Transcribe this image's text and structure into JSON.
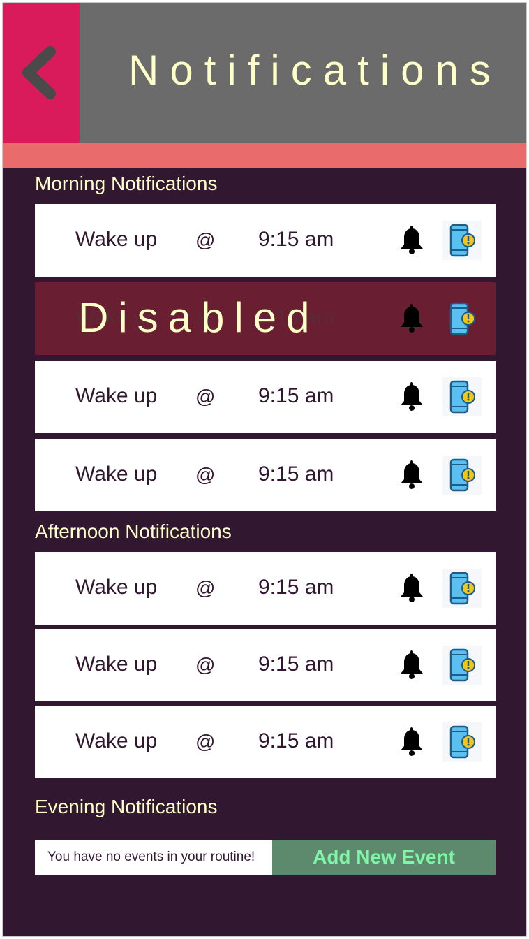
{
  "header": {
    "title": "Notifications",
    "back_icon": "chevron-left-icon",
    "colors": {
      "bar": "#6b6b6b",
      "back": "#d91b5c",
      "strip": "#ea6b6b"
    }
  },
  "sections": {
    "morning": {
      "title": "Morning Notifications",
      "items": [
        {
          "label": "Wake up",
          "at": "@",
          "time": "9:15 am",
          "disabled": false
        },
        {
          "label": "Wake up",
          "at": "@",
          "time": "9:15 am",
          "disabled": true,
          "overlay": "Disabled"
        },
        {
          "label": "Wake up",
          "at": "@",
          "time": "9:15 am",
          "disabled": false
        },
        {
          "label": "Wake up",
          "at": "@",
          "time": "9:15 am",
          "disabled": false
        }
      ]
    },
    "afternoon": {
      "title": "Afternoon Notifications",
      "items": [
        {
          "label": "Wake up",
          "at": "@",
          "time": "9:15 am",
          "disabled": false
        },
        {
          "label": "Wake up",
          "at": "@",
          "time": "9:15 am",
          "disabled": false
        },
        {
          "label": "Wake up",
          "at": "@",
          "time": "9:15 am",
          "disabled": false
        }
      ]
    },
    "evening": {
      "title": "Evening Notifications",
      "empty_message": "You have no events in your routine!",
      "add_button": "Add New Event"
    }
  },
  "icons": {
    "bell": "bell-icon",
    "phone": "phone-alert-icon"
  },
  "colors": {
    "background": "#311830",
    "text": "#ffffc8",
    "disabled": "#6a1e32",
    "add_button": "#5d8a6c"
  }
}
